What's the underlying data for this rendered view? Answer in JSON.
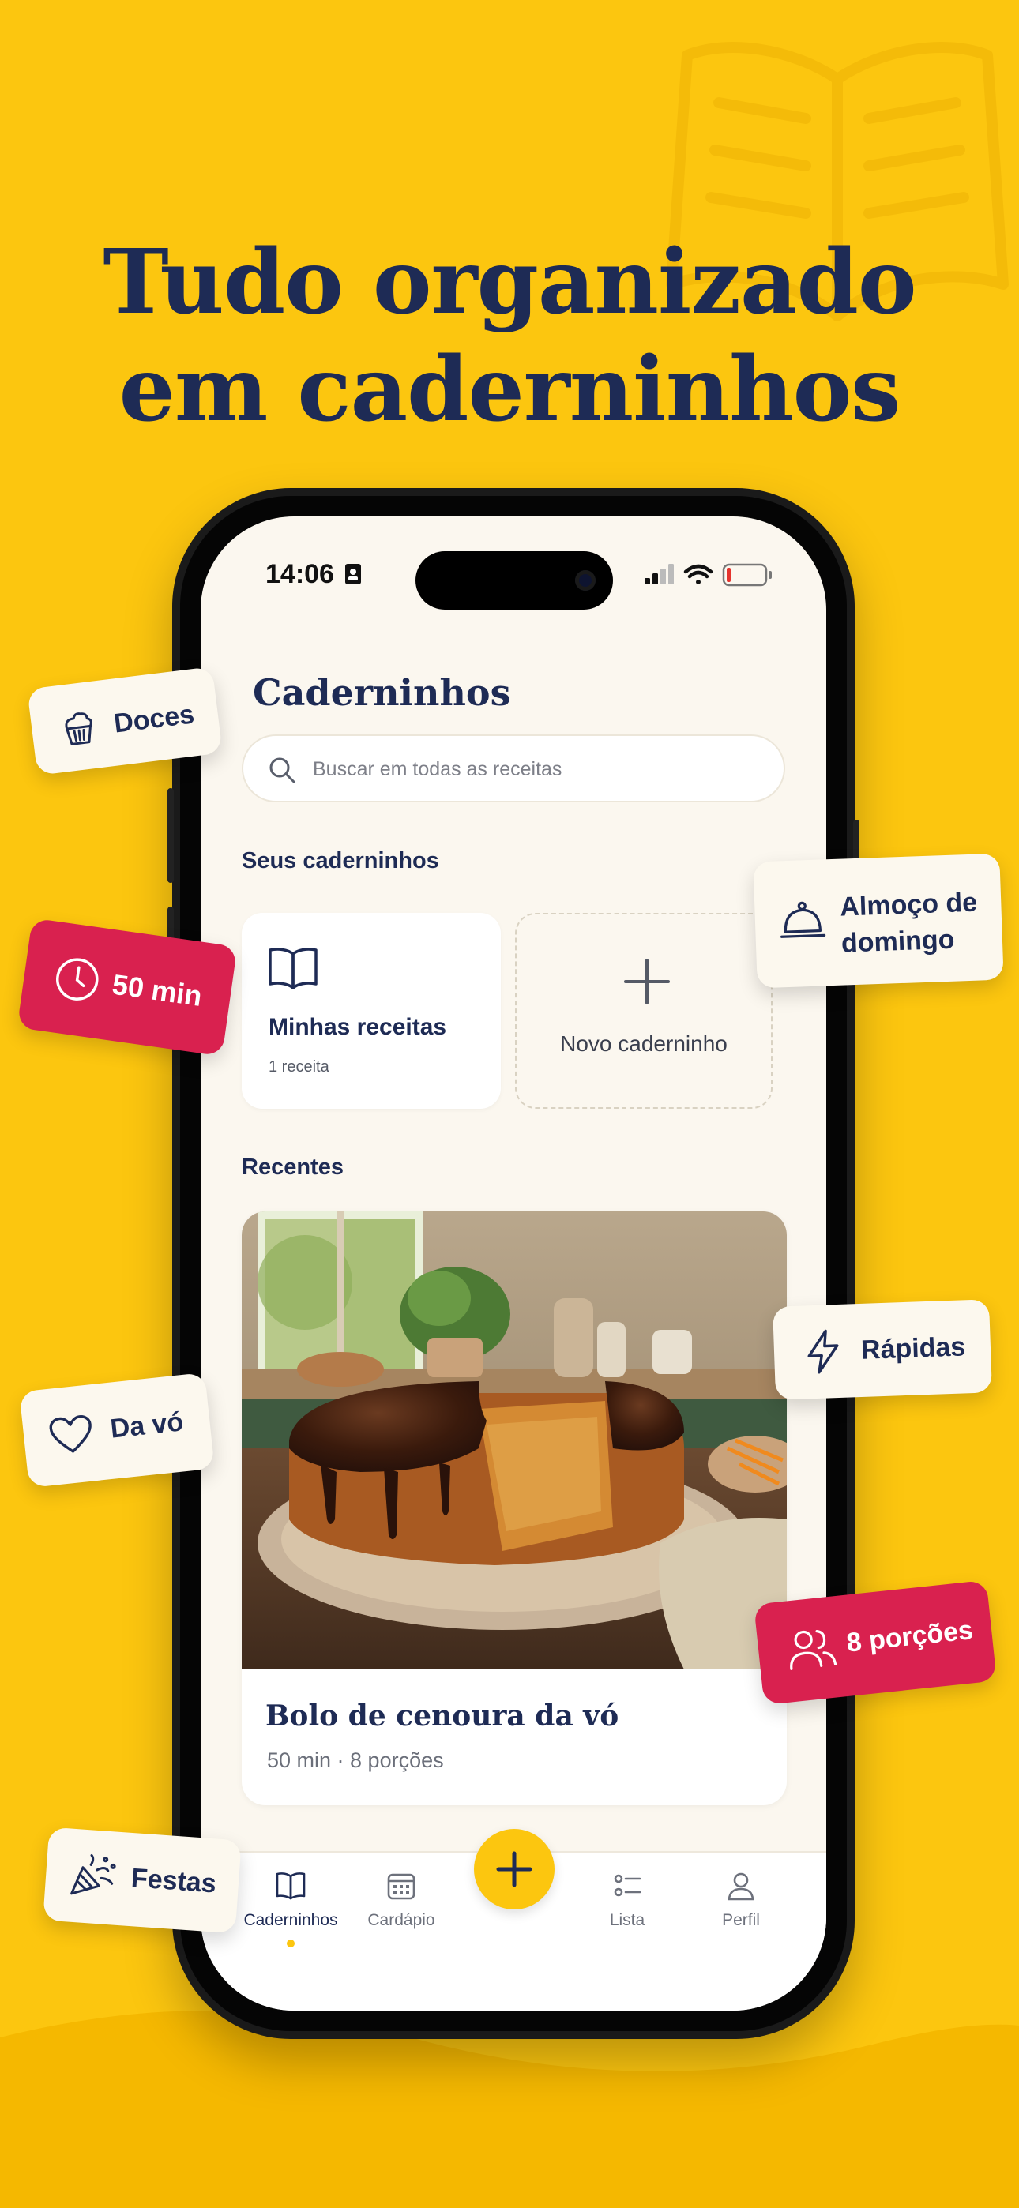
{
  "headline": {
    "line1": "Tudo organizado",
    "line2": "em caderninhos"
  },
  "status_bar": {
    "time": "14:06"
  },
  "screen": {
    "title": "Caderninhos",
    "search": {
      "placeholder": "Buscar em todas as receitas"
    },
    "notebooks_section": {
      "label": "Seus caderninhos",
      "notebook": {
        "name": "Minhas receitas",
        "count": "1 receita"
      },
      "new_notebook_label": "Novo caderninho"
    },
    "recent_section": {
      "label": "Recentes",
      "recipe": {
        "title": "Bolo de cenoura da vó",
        "meta": "50 min · 8 porções"
      }
    }
  },
  "tab_bar": {
    "tabs": [
      {
        "label": "Caderninhos",
        "icon": "book-icon",
        "active": true
      },
      {
        "label": "Cardápio",
        "icon": "calendar-icon"
      },
      {
        "label": "Lista",
        "icon": "checklist-icon"
      },
      {
        "label": "Perfil",
        "icon": "person-icon"
      }
    ],
    "fab_icon": "plus-icon"
  },
  "stickers": {
    "doces": "Doces",
    "tempo": "50 min",
    "almoco_line1": "Almoço de",
    "almoco_line2": "domingo",
    "rapidas": "Rápidas",
    "da_vo": "Da vó",
    "porcoes": "8 porções",
    "festas": "Festas"
  },
  "colors": {
    "background": "#FCC60F",
    "navy": "#1E2B55",
    "accent_red": "#D9214F",
    "screen": "#FBF7EF"
  }
}
